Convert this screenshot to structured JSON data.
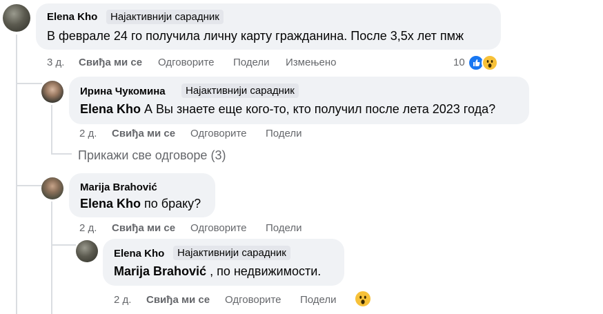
{
  "colors": {
    "bubble": "#f0f2f5",
    "meta": "#65676b",
    "like": "#1877f2",
    "wow": "#f7c139",
    "badge": "#e4e6eb"
  },
  "comment1": {
    "author": "Elena Kho",
    "badge": "Најактивнији сарадник",
    "text": "В феврале 24 го получила личну карту гражданина. После 3,5х лет пмж",
    "time": "3 д.",
    "like": "Свиђа ми се",
    "reply": "Одговорите",
    "share": "Подели",
    "edited": "Измењено",
    "reaction_count": "10"
  },
  "reply1": {
    "author": "Ирина Чукомина",
    "badge": "Најактивнији сарадник",
    "mention": "Elena Kho",
    "text": " А Вы знаете еще кого-то, кто получил после лета 2023 года?",
    "time": "2 д.",
    "like": "Свиђа ми се",
    "reply": "Одговорите",
    "share": "Подели"
  },
  "show_all_replies": "Прикажи све одговоре (3)",
  "reply2": {
    "author": "Marija Brahović",
    "mention": "Elena Kho",
    "text": " по браку?",
    "time": "2 д.",
    "like": "Свиђа ми се",
    "reply": "Одговорите",
    "share": "Подели"
  },
  "reply3": {
    "author": "Elena Kho",
    "badge": "Најактивнији сарадник",
    "mention": "Marija Brahović",
    "text": " , по недвижимости.",
    "time": "2 д.",
    "like": "Свиђа ми се",
    "reply": "Одговорите",
    "share": "Подели"
  }
}
